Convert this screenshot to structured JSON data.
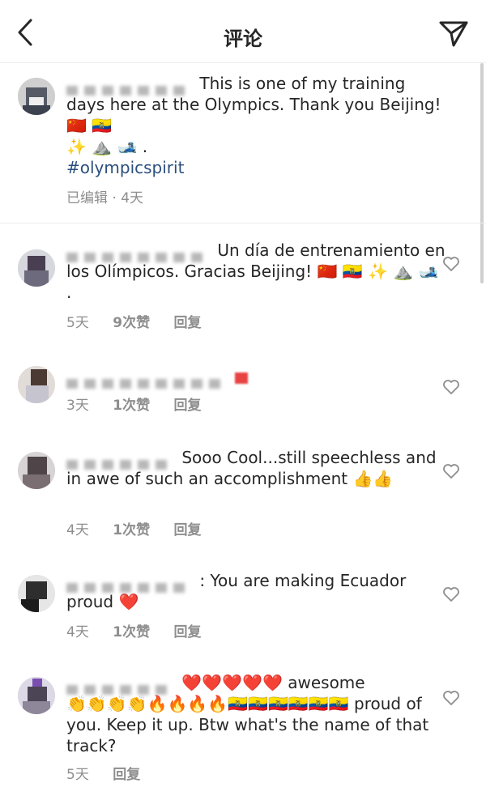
{
  "header": {
    "title": "评论"
  },
  "caption": {
    "text": "This is one of my training days here at the Olympics. Thank you Beijing!",
    "emojis_line1": "🇨🇳 🇪🇨",
    "emojis_line2": "✨ ⛰️ 🎿 .",
    "hashtag": "#olympicspirit",
    "meta": "已编辑 · 4天"
  },
  "comments": [
    {
      "text": "Un día de entrenamiento en los Olímpicos. Gracias Beijing!",
      "emojis": "🇨🇳 🇪🇨 ✨ ⛰️ 🎿 .",
      "time": "5天",
      "likes": "9次赞",
      "reply": "回复"
    },
    {
      "text": "",
      "emojis": "",
      "time": "3天",
      "likes": "1次赞",
      "reply": "回复"
    },
    {
      "text": "Sooo Cool...still speechless and in awe of such an accomplishment",
      "emojis": "👍👍",
      "time": "4天",
      "likes": "1次赞",
      "reply": "回复"
    },
    {
      "text": ": You are making Ecuador proud",
      "emojis": "❤️",
      "time": "4天",
      "likes": "1次赞",
      "reply": "回复"
    },
    {
      "text_pre": "❤️❤️❤️❤️❤️",
      "text": "awesome",
      "emojis": "👏👏👏👏🔥🔥🔥🔥🇪🇨🇪🇨🇪🇨🇪🇨🇪🇨🇪🇨",
      "text_post": "proud of you. Keep it up. Btw what's the name of that track?",
      "time": "5天",
      "reply": "回复"
    }
  ]
}
